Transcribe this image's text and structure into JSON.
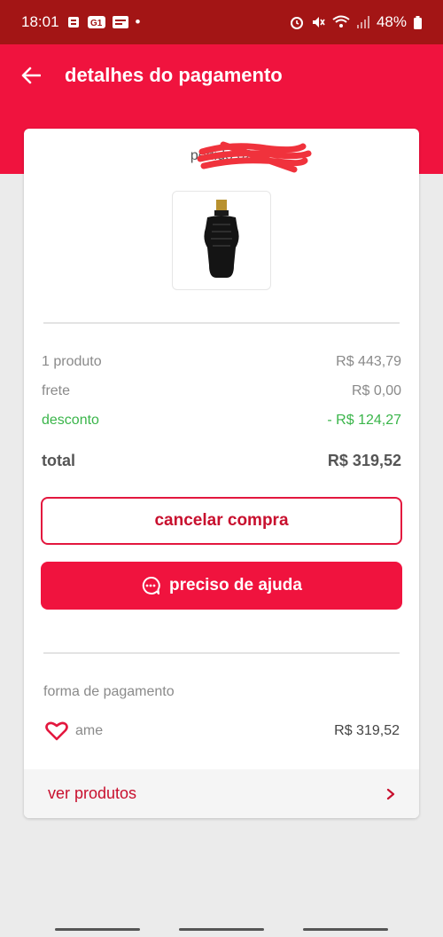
{
  "status_bar": {
    "time": "18:01",
    "battery": "48%",
    "dot": "•"
  },
  "header": {
    "title": "detalhes do pagamento",
    "back_icon": "arrow-left-icon"
  },
  "order": {
    "label": "pedido 02"
  },
  "summary": {
    "products_label": "1 produto",
    "products_value": "R$ 443,79",
    "shipping_label": "frete",
    "shipping_value": "R$ 0,00",
    "discount_label": "desconto",
    "discount_value": "- R$ 124,27",
    "total_label": "total",
    "total_value": "R$ 319,52"
  },
  "actions": {
    "cancel_label": "cancelar compra",
    "help_label": "preciso de ajuda"
  },
  "payment": {
    "section_label": "forma de pagamento",
    "method": "ame",
    "amount": "R$ 319,52"
  },
  "footer": {
    "link_label": "ver produtos"
  },
  "colors": {
    "brand_red": "#f0133e",
    "status_bar": "#a31515",
    "discount_green": "#3ab54a"
  }
}
